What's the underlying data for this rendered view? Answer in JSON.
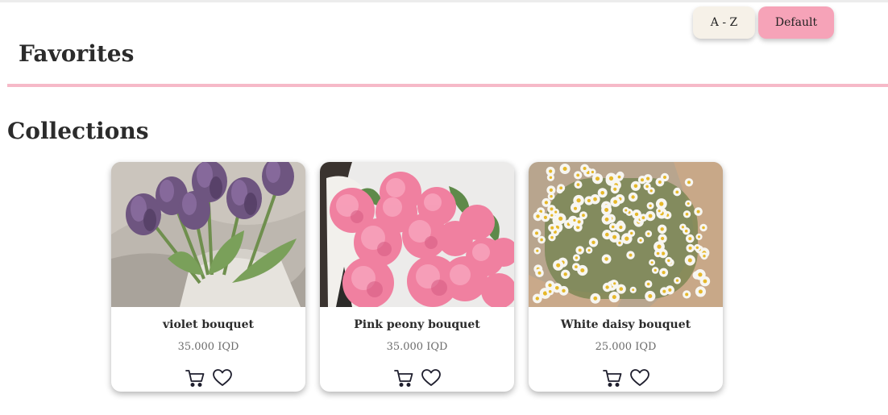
{
  "sort": {
    "az_label": "A - Z",
    "default_label": "Default"
  },
  "header": {
    "title": "Favorites"
  },
  "collections": {
    "title": "Collections",
    "items": [
      {
        "name": "violet bouquet",
        "price": "35.000 IQD",
        "image": "purple-tulips-photo"
      },
      {
        "name": "Pink peony bouquet",
        "price": "35.000 IQD",
        "image": "pink-peonies-photo"
      },
      {
        "name": "White daisy bouquet",
        "price": "25.000 IQD",
        "image": "white-daisies-photo"
      }
    ]
  },
  "icons": {
    "cart": "cart-icon",
    "favorite": "heart-icon"
  },
  "colors": {
    "accent_pink": "#f6a3b8",
    "rule_pink": "#f6b9c8",
    "cream": "#f6f1e8",
    "text": "#2b2b2b"
  }
}
